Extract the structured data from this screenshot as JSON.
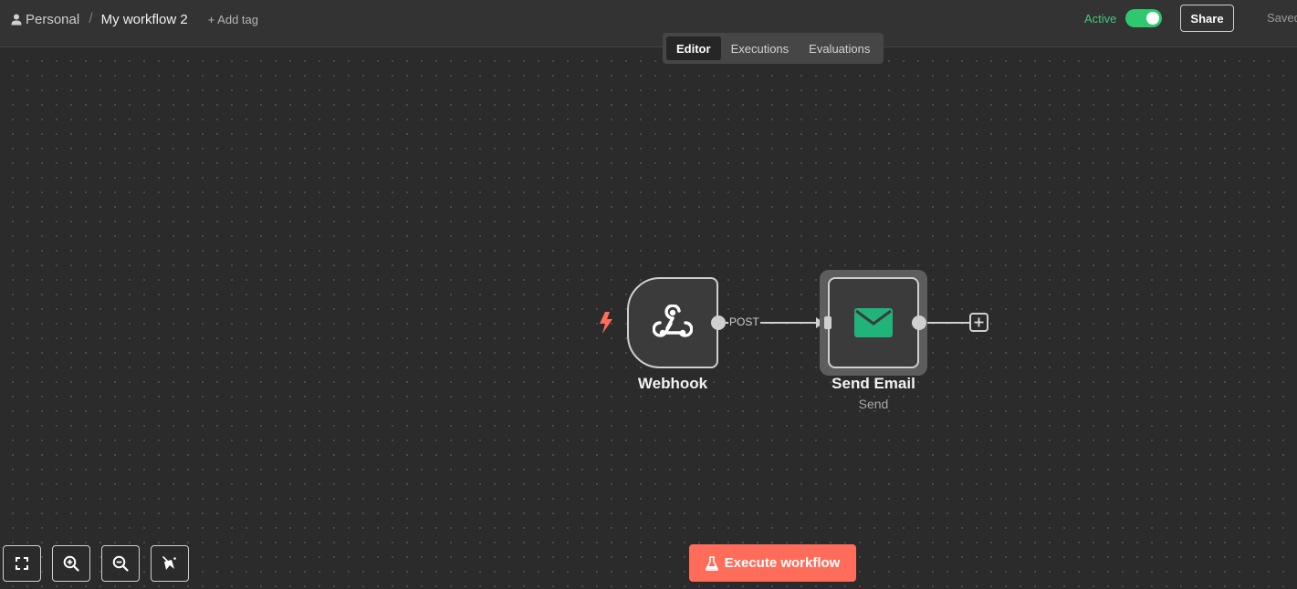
{
  "header": {
    "breadcrumb_project": "Personal",
    "workflow_name": "My workflow 2",
    "add_tag_label": "+ Add tag",
    "active_label": "Active",
    "active_state": true,
    "share_label": "Share",
    "saved_label": "Saved"
  },
  "tabs": [
    {
      "label": "Editor",
      "active": true
    },
    {
      "label": "Executions",
      "active": false
    },
    {
      "label": "Evaluations",
      "active": false
    }
  ],
  "nodes": {
    "webhook": {
      "title": "Webhook",
      "icon": "webhook-icon",
      "is_trigger": true
    },
    "send_email": {
      "title": "Send Email",
      "subtitle": "Send",
      "icon": "envelope-icon",
      "selected": true
    }
  },
  "connection": {
    "label": "POST"
  },
  "controls": {
    "fit_view_icon": "fit-view-icon",
    "zoom_in_icon": "zoom-in-icon",
    "zoom_out_icon": "zoom-out-icon",
    "tidy_up_icon": "tidy-up-icon"
  },
  "execute_button": {
    "label": "Execute workflow",
    "icon": "flask-icon"
  },
  "colors": {
    "accent": "#ff6d5a",
    "active_green": "#2fc86f",
    "email_icon": "#20b37a",
    "trigger_bolt": "#ff6d5a"
  }
}
